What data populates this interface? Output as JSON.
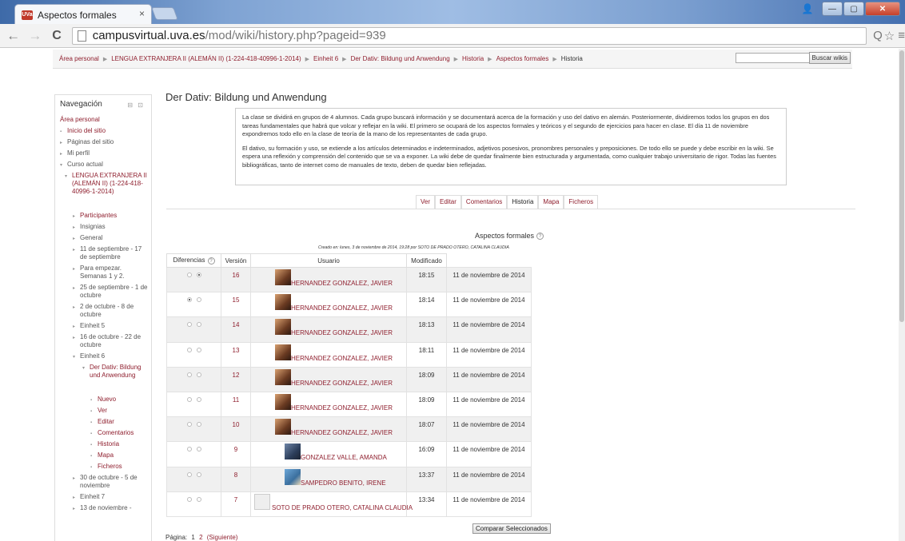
{
  "browser": {
    "tab_title": "Aspectos formales",
    "tab_close": "×",
    "favicon_text": "UVa",
    "url_host": "campusvirtual.uva.es",
    "url_path": "/mod/wiki/history.php?pageid=939",
    "back_icon": "←",
    "forward_icon": "→",
    "reload_icon": "C",
    "zoom_icon": "Q",
    "star_icon": "☆",
    "menu_icon": "≡"
  },
  "breadcrumb": [
    "Área personal",
    "LENGUA EXTRANJERA II (ALEMÁN II) (1-224-418-40996-1-2014)",
    "Einheit 6",
    "Der Dativ: Bildung und Anwendung",
    "Historia",
    "Aspectos formales",
    "Historia"
  ],
  "search": {
    "button_label": "Buscar wikis"
  },
  "sidebar": {
    "title": "Navegación",
    "items": [
      {
        "label": "Área personal",
        "marker": "",
        "indent": 0,
        "link": true
      },
      {
        "label": "Inicio del sitio",
        "marker": "▪",
        "indent": 1,
        "link": true
      },
      {
        "label": "Páginas del sitio",
        "marker": "▸",
        "indent": 1,
        "link": false
      },
      {
        "label": "Mi perfil",
        "marker": "▸",
        "indent": 1,
        "link": false
      },
      {
        "label": "Curso actual",
        "marker": "▾",
        "indent": 1,
        "link": false
      },
      {
        "label": "LENGUA EXTRANJERA II (ALEMÁN II) (1-224-418-40996-1-2014)",
        "marker": "▾",
        "indent": 2,
        "link": true
      },
      {
        "label": "Participantes",
        "marker": "▸",
        "indent": 3,
        "link": true
      },
      {
        "label": "Insignias",
        "marker": "▸",
        "indent": 3,
        "link": false
      },
      {
        "label": "General",
        "marker": "▸",
        "indent": 3,
        "link": false
      },
      {
        "label": "11 de septiembre - 17 de septiembre",
        "marker": "▸",
        "indent": 3,
        "link": false
      },
      {
        "label": "Para empezar. Semanas 1 y 2.",
        "marker": "▸",
        "indent": 3,
        "link": false
      },
      {
        "label": "25 de septiembre - 1 de octubre",
        "marker": "▸",
        "indent": 3,
        "link": false
      },
      {
        "label": "2 de octubre - 8 de octubre",
        "marker": "▸",
        "indent": 3,
        "link": false
      },
      {
        "label": "Einheit 5",
        "marker": "▸",
        "indent": 3,
        "link": false
      },
      {
        "label": "16 de octubre - 22 de octubre",
        "marker": "▸",
        "indent": 3,
        "link": false
      },
      {
        "label": "Einheit 6",
        "marker": "▾",
        "indent": 3,
        "link": false
      },
      {
        "label": "Der Dativ: Bildung und Anwendung",
        "marker": "▾",
        "indent": 4,
        "link": true
      },
      {
        "label": "Nuevo",
        "marker": "▪",
        "indent": 5,
        "link": true
      },
      {
        "label": "Ver",
        "marker": "▪",
        "indent": 5,
        "link": true
      },
      {
        "label": "Editar",
        "marker": "▪",
        "indent": 5,
        "link": true
      },
      {
        "label": "Comentarios",
        "marker": "▪",
        "indent": 5,
        "link": true
      },
      {
        "label": "Historia",
        "marker": "▪",
        "indent": 5,
        "link": true
      },
      {
        "label": "Mapa",
        "marker": "▪",
        "indent": 5,
        "link": true
      },
      {
        "label": "Ficheros",
        "marker": "▪",
        "indent": 5,
        "link": true
      },
      {
        "label": "30 de octubre - 5 de noviembre",
        "marker": "▸",
        "indent": 3,
        "link": false
      },
      {
        "label": "Einheit 7",
        "marker": "▸",
        "indent": 3,
        "link": false
      },
      {
        "label": "13 de noviembre -",
        "marker": "▸",
        "indent": 3,
        "link": false
      }
    ]
  },
  "main": {
    "title": "Der Dativ: Bildung und Anwendung",
    "intro_p1": "La clase se dividirá en grupos de 4 alumnos. Cada grupo buscará información y se documentará acerca de la formación y uso del dativo en alemán. Posteriormente, dividiremos todos los grupos en dos tareas fundamentales que habrá que volcar y reflejar en la wiki. El primero se ocupará de los aspectos formales y teóricos y el segundo de ejercicios para hacer en clase. El día 11 de noviembre expondremos todo ello en la clase de teoría de la mano de los representantes de cada grupo.",
    "intro_p2": "El dativo, su formación y uso, se extiende a los artículos determinados e indeterminados, adjetivos posesivos, pronombres personales y preposiciones. De todo ello se puede y debe escribir en la wiki. Se espera una reflexión y comprensión del contenido que se va a exponer. La wiki debe de quedar finalmente bien estructurada y argumentada, como cualquier trabajo universitario de rigor. Todas las fuentes bibliográficas, tanto de internet como de manuales de texto, deben de quedar bien reflejadas.",
    "tabs": [
      "Ver",
      "Editar",
      "Comentarios",
      "Historia",
      "Mapa",
      "Ficheros"
    ],
    "active_tab": "Historia",
    "page_heading": "Aspectos formales",
    "help_icon": "?",
    "created_text": "Creado en: lunes, 3 de noviembre de 2014, 19:28 por SOTO DE PRADO OTERO, CATALINA CLAUDIA"
  },
  "history": {
    "headers": [
      "Diferencias",
      "Versión",
      "Usuario",
      "Modificado",
      ""
    ],
    "rows": [
      {
        "version": "16",
        "user": "HERNANDEZ GONZALEZ, JAVIER",
        "time": "18:15",
        "date": "11 de noviembre de 2014",
        "left_selected": false,
        "right_selected": true,
        "left_enabled": false,
        "avatar": "hj"
      },
      {
        "version": "15",
        "user": "HERNANDEZ GONZALEZ, JAVIER",
        "time": "18:14",
        "date": "11 de noviembre de 2014",
        "left_selected": true,
        "right_selected": false,
        "left_enabled": true,
        "avatar": "hj"
      },
      {
        "version": "14",
        "user": "HERNANDEZ GONZALEZ, JAVIER",
        "time": "18:13",
        "date": "11 de noviembre de 2014",
        "left_selected": false,
        "right_selected": false,
        "left_enabled": true,
        "avatar": "hj"
      },
      {
        "version": "13",
        "user": "HERNANDEZ GONZALEZ, JAVIER",
        "time": "18:11",
        "date": "11 de noviembre de 2014",
        "left_selected": false,
        "right_selected": false,
        "left_enabled": true,
        "avatar": "hj"
      },
      {
        "version": "12",
        "user": "HERNANDEZ GONZALEZ, JAVIER",
        "time": "18:09",
        "date": "11 de noviembre de 2014",
        "left_selected": false,
        "right_selected": false,
        "left_enabled": true,
        "avatar": "hj"
      },
      {
        "version": "11",
        "user": "HERNANDEZ GONZALEZ, JAVIER",
        "time": "18:09",
        "date": "11 de noviembre de 2014",
        "left_selected": false,
        "right_selected": false,
        "left_enabled": true,
        "avatar": "hj"
      },
      {
        "version": "10",
        "user": "HERNANDEZ GONZALEZ, JAVIER",
        "time": "18:07",
        "date": "11 de noviembre de 2014",
        "left_selected": false,
        "right_selected": false,
        "left_enabled": true,
        "avatar": "hj"
      },
      {
        "version": "9",
        "user": "GONZALEZ VALLE, AMANDA",
        "time": "16:09",
        "date": "11 de noviembre de 2014",
        "left_selected": false,
        "right_selected": false,
        "left_enabled": true,
        "avatar": "gv"
      },
      {
        "version": "8",
        "user": "SAMPEDRO BENITO, IRENE",
        "time": "13:37",
        "date": "11 de noviembre de 2014",
        "left_selected": false,
        "right_selected": false,
        "left_enabled": true,
        "avatar": "sb"
      },
      {
        "version": "7",
        "user": "SOTO DE PRADO OTERO, CATALINA CLAUDIA",
        "time": "13:34",
        "date": "11 de noviembre de 2014",
        "left_selected": false,
        "right_selected": false,
        "left_enabled": true,
        "avatar": "so"
      }
    ],
    "compare_label": "Comparar Seleccionados"
  },
  "paging": {
    "label": "Página:",
    "page1": "1",
    "page2": "2",
    "next": "(Siguiente)"
  }
}
